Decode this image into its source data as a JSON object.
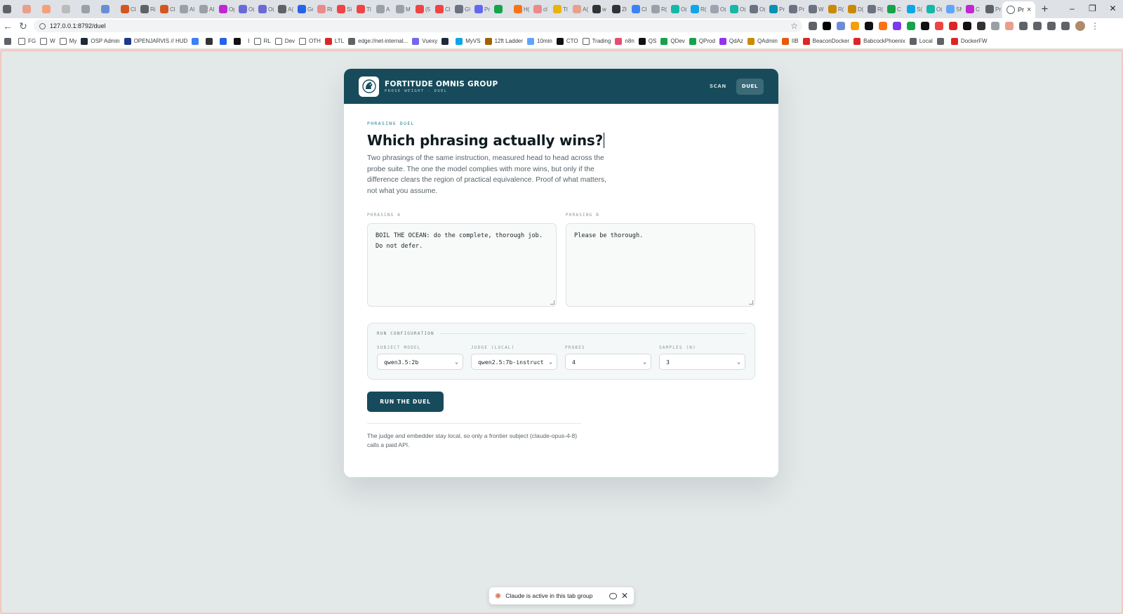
{
  "browser": {
    "tabs": [
      {
        "icon": "app-icon",
        "color": "#5f6368"
      },
      {
        "icon": "claude-icon",
        "color": "#e8a08c"
      },
      {
        "icon": "orange-icon",
        "color": "#f4a07a"
      },
      {
        "icon": "k-icon",
        "color": "#bbbbbb"
      },
      {
        "icon": "grid-icon",
        "color": "#9aa0a6"
      },
      {
        "icon": "chart-icon",
        "color": "#6a8ed6"
      },
      {
        "icon": "cla-icon",
        "color": "#d4561f",
        "text": "Cla"
      },
      {
        "icon": "globe-icon",
        "color": "#5f6368",
        "text": "Ri"
      },
      {
        "icon": "cla-icon",
        "color": "#d4561f",
        "text": "Cla"
      },
      {
        "icon": "al-icon",
        "color": "#9aa0a6",
        "text": "Al"
      },
      {
        "icon": "al-icon",
        "color": "#9aa0a6",
        "text": "Al"
      },
      {
        "icon": "op-icon",
        "color": "#c026d3",
        "text": "Op"
      },
      {
        "icon": "o-icon",
        "color": "#6a6ad6",
        "text": "O("
      },
      {
        "icon": "o-icon",
        "color": "#6a6ad6",
        "text": "O("
      },
      {
        "icon": "a-icon",
        "color": "#5f6368",
        "text": "A("
      },
      {
        "icon": "grc-icon",
        "color": "#2563eb",
        "text": "Grc"
      },
      {
        "icon": "r-icon",
        "color": "#ea8a8a",
        "text": "Ri"
      },
      {
        "icon": "youtube-icon",
        "color": "#ef4444",
        "text": "Si"
      },
      {
        "icon": "youtube-icon",
        "color": "#ef4444",
        "text": "Tl"
      },
      {
        "icon": "s-icon",
        "color": "#9aa0a6",
        "text": "A"
      },
      {
        "icon": "m-icon",
        "color": "#9aa0a6",
        "text": "M"
      },
      {
        "icon": "youtube-icon",
        "color": "#ef4444",
        "text": "(5"
      },
      {
        "icon": "youtube-icon",
        "color": "#ef4444",
        "text": "Cl"
      },
      {
        "icon": "g-icon",
        "color": "#6b7280",
        "text": "G\\"
      },
      {
        "icon": "p-icon",
        "color": "#6366f1",
        "text": "Pr"
      },
      {
        "icon": "check-icon",
        "color": "#16a34a",
        "text": ""
      },
      {
        "icon": "h-icon",
        "color": "#f97316",
        "text": "H("
      },
      {
        "icon": "link-icon",
        "color": "#ea8a8a",
        "text": "cl"
      },
      {
        "icon": "sun-icon",
        "color": "#eab308",
        "text": "Tl"
      },
      {
        "icon": "claude-icon",
        "color": "#e8a08c",
        "text": "A("
      },
      {
        "icon": "github-icon",
        "color": "#333333",
        "text": "w"
      },
      {
        "icon": "github-icon",
        "color": "#333333",
        "text": "Zł"
      },
      {
        "icon": "c-icon",
        "color": "#3b82f6",
        "text": "Cl"
      },
      {
        "icon": "r-icon",
        "color": "#9aa0a6",
        "text": "R("
      },
      {
        "icon": "o-icon",
        "color": "#14b8a6",
        "text": "O("
      },
      {
        "icon": "r-icon",
        "color": "#0ea5e9",
        "text": "R("
      },
      {
        "icon": "leaf-icon",
        "color": "#9ca3af",
        "text": "O("
      },
      {
        "icon": "o-icon",
        "color": "#14b8a6",
        "text": "O("
      },
      {
        "icon": "o-icon",
        "color": "#6b7280",
        "text": "O("
      },
      {
        "icon": "p-icon",
        "color": "#0891b2",
        "text": "Pr"
      },
      {
        "icon": "p-icon",
        "color": "#6b7280",
        "text": "Pr"
      },
      {
        "icon": "w-icon",
        "color": "#6b7280",
        "text": "W"
      },
      {
        "icon": "pencil-icon",
        "color": "#ca8a04",
        "text": "R("
      },
      {
        "icon": "pencil-icon",
        "color": "#ca8a04",
        "text": "D("
      },
      {
        "icon": "r-icon",
        "color": "#6b7280",
        "text": "R("
      },
      {
        "icon": "check-icon",
        "color": "#16a34a",
        "text": "C"
      },
      {
        "icon": "s-icon",
        "color": "#0ea5e9",
        "text": "S("
      },
      {
        "icon": "o-icon",
        "color": "#14b8a6",
        "text": "O("
      },
      {
        "icon": "sm-icon",
        "color": "#60a5fa",
        "text": "SM"
      },
      {
        "icon": "hourglass-icon",
        "color": "#c026d3",
        "text": "C"
      },
      {
        "icon": "globe-icon",
        "color": "#5f6368",
        "text": "Pr"
      }
    ],
    "active_tab_label": "Pr",
    "window_controls": [
      "–",
      "❐",
      "✕"
    ],
    "url": "127.0.0.1:8792/duel",
    "bookmarks": [
      {
        "label": "",
        "icon": "bookmark-app-icon",
        "color": "#5f6368"
      },
      {
        "label": "FG",
        "icon": "folder-icon",
        "color": "#5f6368"
      },
      {
        "label": "W",
        "icon": "folder-icon",
        "color": "#5f6368"
      },
      {
        "label": "My",
        "icon": "folder-icon",
        "color": "#5f6368"
      },
      {
        "label": "OSP Admin",
        "icon": "osp-icon",
        "color": "#1f2937"
      },
      {
        "label": "OPENJARVIS // HUD",
        "icon": "jarvis-icon",
        "color": "#1e3a8a"
      },
      {
        "label": "",
        "icon": "link-icon",
        "color": "#3b82f6"
      },
      {
        "label": "",
        "icon": "apple-icon",
        "color": "#333333"
      },
      {
        "label": "",
        "icon": "a-icon",
        "color": "#2563eb"
      },
      {
        "label": "",
        "icon": "doc-icon",
        "color": "#111111"
      },
      {
        "label": "I",
        "icon": "",
        "color": ""
      },
      {
        "label": "RL",
        "icon": "folder-icon",
        "color": "#5f6368"
      },
      {
        "label": "Dev",
        "icon": "folder-icon",
        "color": "#5f6368"
      },
      {
        "label": "OTH",
        "icon": "folder-icon",
        "color": "#5f6368"
      },
      {
        "label": "LTL",
        "icon": "ltl-icon",
        "color": "#dc2626"
      },
      {
        "label": "edge://net-internal...",
        "icon": "globe-icon",
        "color": "#5f6368"
      },
      {
        "label": "Vuexy",
        "icon": "vuexy-icon",
        "color": "#7367f0"
      },
      {
        "label": "",
        "icon": "g-icon",
        "color": "#1f2937"
      },
      {
        "label": "MyVS",
        "icon": "vs-icon",
        "color": "#0ea5e9"
      },
      {
        "label": "12ft Ladder",
        "icon": "ladder-icon",
        "color": "#a16207"
      },
      {
        "label": "10min",
        "icon": "mail-icon",
        "color": "#60a5fa"
      },
      {
        "label": "CTO",
        "icon": "github-icon",
        "color": "#111111"
      },
      {
        "label": "Trading",
        "icon": "folder-icon",
        "color": "#5f6368"
      },
      {
        "label": "n8n",
        "icon": "n8n-icon",
        "color": "#ea4b71"
      },
      {
        "label": "QS",
        "icon": "qs-icon",
        "color": "#111111"
      },
      {
        "label": "QDev",
        "icon": "q-icon",
        "color": "#16a34a"
      },
      {
        "label": "QProd",
        "icon": "q-icon",
        "color": "#16a34a"
      },
      {
        "label": "QdAz",
        "icon": "qdaz-icon",
        "color": "#9333ea"
      },
      {
        "label": "QAdmin",
        "icon": "vue-icon",
        "color": "#ca8a04"
      },
      {
        "label": "IIB",
        "icon": "iib-icon",
        "color": "#ea580c"
      },
      {
        "label": "BeaconDocker",
        "icon": "beacon-icon",
        "color": "#dc2626"
      },
      {
        "label": "BabcockPhoenix",
        "icon": "beacon-icon",
        "color": "#dc2626"
      },
      {
        "label": "Local",
        "icon": "local-icon",
        "color": "#5f6368"
      },
      {
        "label": "",
        "icon": "tree-icon",
        "color": "#5f6368"
      },
      {
        "label": "DockerFW",
        "icon": "beacon-icon",
        "color": "#dc2626"
      }
    ],
    "extensions": [
      "#5f6368",
      "#000000",
      "#6b8cd6",
      "#f59e0b",
      "#111111",
      "#f97316",
      "#7c3aed",
      "#16a34a",
      "#111111",
      "#ef4444",
      "#dc2626",
      "#111111",
      "#333333",
      "#9aa0a6",
      "#e8a08c",
      "#5f6368",
      "#5f6368",
      "#5f6368",
      "#5f6368"
    ]
  },
  "header": {
    "brand_name": "FORTITUDE OMNIS GROUP",
    "brand_sub": "PROSE WEIGHT · DUEL",
    "nav": [
      {
        "label": "SCAN",
        "active": false
      },
      {
        "label": "DUEL",
        "active": true
      }
    ]
  },
  "main": {
    "eyebrow": "PHRASING DUEL",
    "title": "Which phrasing actually wins?",
    "lede": "Two phrasings of the same instruction, measured head to head across the probe suite. The one the model complies with more wins, but only if the difference clears the region of practical equivalence. Proof of what matters, not what you assume.",
    "phrase_a": {
      "label": "PHRASING A",
      "value": "BOIL THE OCEAN: do the complete, thorough job.\nDo not defer."
    },
    "phrase_b": {
      "label": "PHRASING B",
      "value": "Please be thorough."
    },
    "config": {
      "title": "RUN CONFIGURATION",
      "fields": [
        {
          "label": "SUBJECT MODEL",
          "value": "qwen3.5:2b"
        },
        {
          "label": "JUDGE (LOCAL)",
          "value": "qwen2.5:7b-instruct"
        },
        {
          "label": "PROBES",
          "value": "4"
        },
        {
          "label": "SAMPLES (N)",
          "value": "3"
        }
      ]
    },
    "run_label": "RUN THE DUEL",
    "footnote": "The judge and embedder stay local, so only a frontier subject (claude-opus-4-8) calls a paid API."
  },
  "toast": {
    "message": "Claude is active in this tab group"
  },
  "colors": {
    "brand": "#174b5b",
    "accent": "#2b7f90",
    "page_bg": "#e3e8e8"
  }
}
